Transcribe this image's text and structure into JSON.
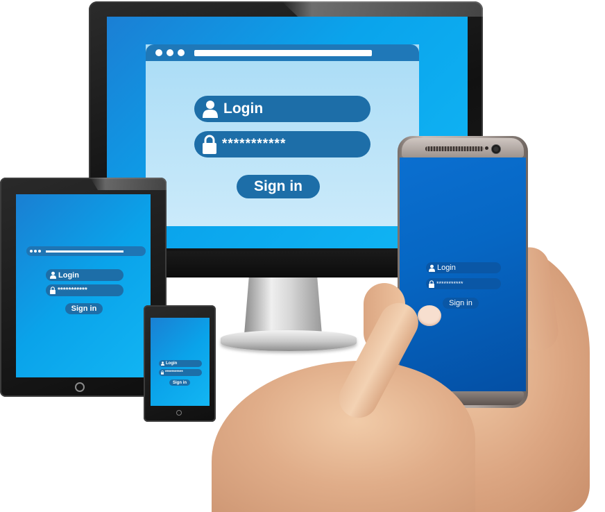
{
  "monitor": {
    "login_label": "Login",
    "password_mask": "***********",
    "signin_label": "Sign in"
  },
  "tablet": {
    "login_label": "Login",
    "password_mask": "***********",
    "signin_label": "Sign in"
  },
  "small_phone": {
    "login_label": "Login",
    "password_mask": "***********",
    "signin_label": "Sign in"
  },
  "big_phone": {
    "login_label": "Login",
    "password_mask": "***********",
    "signin_label": "Sign in"
  },
  "icons": {
    "user": "user-icon",
    "lock": "lock-icon",
    "power": "power-icon"
  },
  "colors": {
    "screen_blue": "#0aa4ec",
    "field_blue": "#1d6ea8",
    "big_phone_screen": "#0667c4",
    "titlebar": "#1f78b8"
  }
}
